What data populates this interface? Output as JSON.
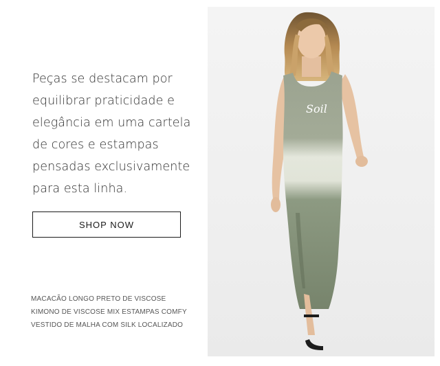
{
  "description_lines": [
    "Peças se destacam por",
    "equilibrar praticidade e",
    "elegância em uma cartela",
    "de cores e estampas",
    "pensadas exclusivamente",
    "para esta linha."
  ],
  "cta": {
    "label": "SHOP NOW"
  },
  "products": [
    "MACACÃO LONGO PRETO DE VISCOSE",
    "KIMONO DE VISCOSE MIX ESTAMPAS COMFY",
    "VESTIDO DE MALHA COM SILK LOCALIZADO"
  ],
  "photo": {
    "dress_print": "Soil",
    "colors": {
      "dress_top": "#9aa28e",
      "dress_mid": "#e6e8dc",
      "dress_bottom": "#7a8770",
      "hair": "#b58a52",
      "skin": "#e9c6a8"
    }
  }
}
